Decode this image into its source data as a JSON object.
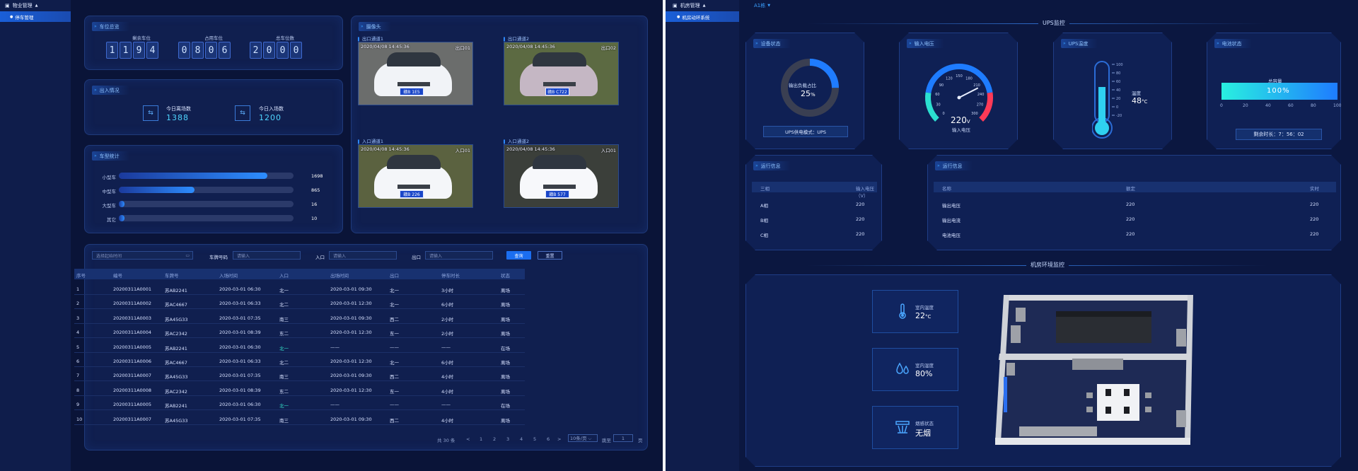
{
  "left_screen": {
    "sidebar": {
      "menu_title": "物业管理",
      "active_item": "停车管理"
    },
    "parking_overview": {
      "title": "车位总览",
      "remaining_label": "剩余车位",
      "remaining_digits": [
        "1",
        "1",
        "9",
        "4"
      ],
      "occupied_label": "占用车位",
      "occupied_digits": [
        "0",
        "8",
        "0",
        "6"
      ],
      "total_label": "总车位数",
      "total_digits": [
        "2",
        "0",
        "0",
        "0"
      ]
    },
    "entry_exit": {
      "title": "出入情况",
      "exit_today_label": "今日离场数",
      "exit_today_value": "1388",
      "entry_today_label": "今日入场数",
      "entry_today_value": "1200"
    },
    "vehicle_stats": {
      "title": "车型统计",
      "max": 2000,
      "rows": [
        {
          "label": "小型车",
          "value": 1698
        },
        {
          "label": "中型车",
          "value": 865
        },
        {
          "label": "大型车",
          "value": 16
        },
        {
          "label": "其它",
          "value": 10
        }
      ]
    },
    "cameras": {
      "title": "摄像头",
      "feeds": [
        {
          "label": "出口通道1",
          "timestamp": "2020/04/08 14:45:36",
          "channel": "出口01",
          "plate": "赣B 1E5",
          "color": "#f1f3f7",
          "bg": "#6b6d6c"
        },
        {
          "label": "出口通道2",
          "timestamp": "2020/04/08 14:45:36",
          "channel": "出口02",
          "plate": "赣B C722",
          "color": "#c5b7c4",
          "bg": "#5c6a42"
        },
        {
          "label": "入口通道1",
          "timestamp": "2020/04/08 14:45:36",
          "channel": "入口01",
          "plate": "赣B 226",
          "color": "#f4f6f9",
          "bg": "#5b6240"
        },
        {
          "label": "入口通道2",
          "timestamp": "2020/04/08 14:45:36",
          "channel": "入口01",
          "plate": "赣B 577",
          "color": "#f7f8fb",
          "bg": "#3b3f3a"
        }
      ]
    },
    "filters": {
      "time_placeholder": "选择起始时间",
      "plate_label": "车牌号码",
      "plate_placeholder": "请输入",
      "entry_label": "入口",
      "entry_placeholder": "请输入",
      "exit_label": "出口",
      "exit_placeholder": "请输入",
      "search_label": "查询",
      "reset_label": "重置"
    },
    "table": {
      "headers": [
        "序号",
        "编号",
        "车牌号",
        "入场时间",
        "入口",
        "出场时间",
        "出口",
        "停车时长",
        "状态"
      ],
      "rows": [
        [
          "1",
          "20200311A0001",
          "苏AB2241",
          "2020-03-01 06:30",
          "北一",
          "2020-03-01 09:30",
          "北一",
          "3小时",
          "离场"
        ],
        [
          "2",
          "20200311A0002",
          "苏AC4667",
          "2020-03-01 06:33",
          "北二",
          "2020-03-01 12:30",
          "北一",
          "6小时",
          "离场"
        ],
        [
          "3",
          "20200311A0003",
          "苏A45G33",
          "2020-03-01 07:35",
          "南三",
          "2020-03-01 09:30",
          "西二",
          "2小时",
          "离场"
        ],
        [
          "4",
          "20200311A0004",
          "苏AC2342",
          "2020-03-01 08:39",
          "东二",
          "2020-03-01 12:30",
          "东一",
          "2小时",
          "离场"
        ],
        [
          "5",
          "20200311A0005",
          "苏AB2241",
          "2020-03-01 06:30",
          "北一",
          "——",
          "——",
          "——",
          "在场"
        ],
        [
          "6",
          "20200311A0006",
          "苏AC4667",
          "2020-03-01 06:33",
          "北二",
          "2020-03-01 12:30",
          "北一",
          "6小时",
          "离场"
        ],
        [
          "7",
          "20200311A0007",
          "苏A45G33",
          "2020-03-01 07:35",
          "南三",
          "2020-03-01 09:30",
          "西二",
          "4小时",
          "离场"
        ],
        [
          "8",
          "20200311A0008",
          "苏AC2342",
          "2020-03-01 08:39",
          "东二",
          "2020-03-01 12:30",
          "东一",
          "4小时",
          "离场"
        ],
        [
          "9",
          "20200311A0005",
          "苏AB2241",
          "2020-03-01 06:30",
          "北一",
          "——",
          "——",
          "——",
          "在场"
        ],
        [
          "10",
          "20200311A0007",
          "苏A45G33",
          "2020-03-01 07:35",
          "南三",
          "2020-03-01 09:30",
          "西二",
          "4小时",
          "离场"
        ]
      ],
      "highlight_color": "#35e0c8"
    },
    "pagination": {
      "total": "共 30 条",
      "prev": "<",
      "pages": [
        "1",
        "2",
        "3",
        "4",
        "5",
        "6"
      ],
      "next": ">",
      "page_size": "10条/页",
      "goto_label": "跳至",
      "goto_value": "1",
      "page_suffix": "页"
    }
  },
  "right_screen": {
    "sidebar": {
      "menu_title": "机房管理",
      "active_item": "机房动环系统"
    },
    "building_select": "A1栋",
    "ups_section_title": "UPS监控",
    "device_status": {
      "title": "设备状态",
      "donut_label": "输出负载占比",
      "donut_value": "25",
      "donut_unit": "%",
      "donut_fraction": 0.25,
      "mode_text": "UPS供电模式：UPS"
    },
    "input_voltage": {
      "title": "输入电压",
      "value": "220",
      "unit": "V",
      "label": "输入电压",
      "gauge_ticks": [
        "0",
        "30",
        "60",
        "90",
        "120",
        "150",
        "180",
        "210",
        "240",
        "270",
        "300"
      ],
      "gauge_value": 220,
      "gauge_max": 300
    },
    "ups_temp": {
      "title": "UPS温度",
      "label": "温度",
      "value": "48",
      "unit": "°C",
      "scale": [
        "100",
        "80",
        "60",
        "40",
        "20",
        "0",
        "-20"
      ]
    },
    "battery": {
      "title": "电池状态",
      "capacity_label": "总容量",
      "capacity_value": "100%",
      "capacity_fraction": 1.0,
      "axis": [
        "0",
        "20",
        "40",
        "60",
        "80",
        "100"
      ],
      "remaining_text": "剩余时长：7：56：02"
    },
    "run_info_1": {
      "title": "运行信息",
      "headers": [
        "三相",
        "输入电压（V）"
      ],
      "rows": [
        [
          "A相",
          "220"
        ],
        [
          "B相",
          "220"
        ],
        [
          "C相",
          "220"
        ]
      ]
    },
    "run_info_2": {
      "title": "运行信息",
      "headers": [
        "名称",
        "额定",
        "实时"
      ],
      "rows": [
        [
          "输出电压",
          "220",
          "220"
        ],
        [
          "输出电流",
          "220",
          "220"
        ],
        [
          "电池电压",
          "220",
          "220"
        ]
      ]
    },
    "env_section_title": "机房环境监控",
    "env": {
      "temp_label": "室内温度",
      "temp_value": "22",
      "temp_unit": "°C",
      "humidity_label": "室内湿度",
      "humidity_value": "80%",
      "smoke_label": "烟感状态",
      "smoke_value": "无烟"
    }
  }
}
